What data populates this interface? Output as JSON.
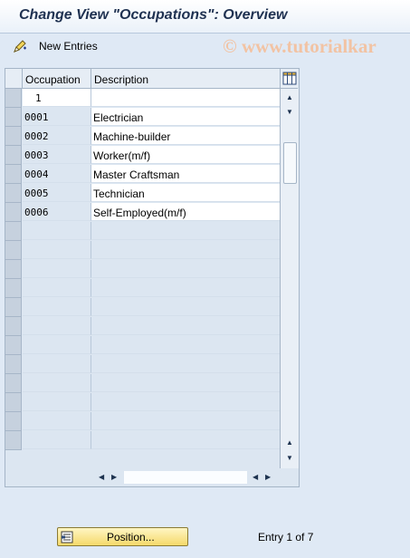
{
  "title": "Change View \"Occupations\": Overview",
  "toolbar": {
    "new_entries_label": "New Entries"
  },
  "watermark": "© www.tutorialkar",
  "table": {
    "columns": [
      "Occupation",
      "Description"
    ],
    "position_value": "1",
    "rows": [
      {
        "occupation": "0001",
        "description": "Electrician"
      },
      {
        "occupation": "0002",
        "description": "Machine-builder"
      },
      {
        "occupation": "0003",
        "description": "Worker(m/f)"
      },
      {
        "occupation": "0004",
        "description": "Master Craftsman"
      },
      {
        "occupation": "0005",
        "description": "Technician"
      },
      {
        "occupation": "0006",
        "description": "Self-Employed(m/f)"
      }
    ]
  },
  "footer": {
    "position_button_label": "Position...",
    "entry_status": "Entry 1 of 7"
  }
}
